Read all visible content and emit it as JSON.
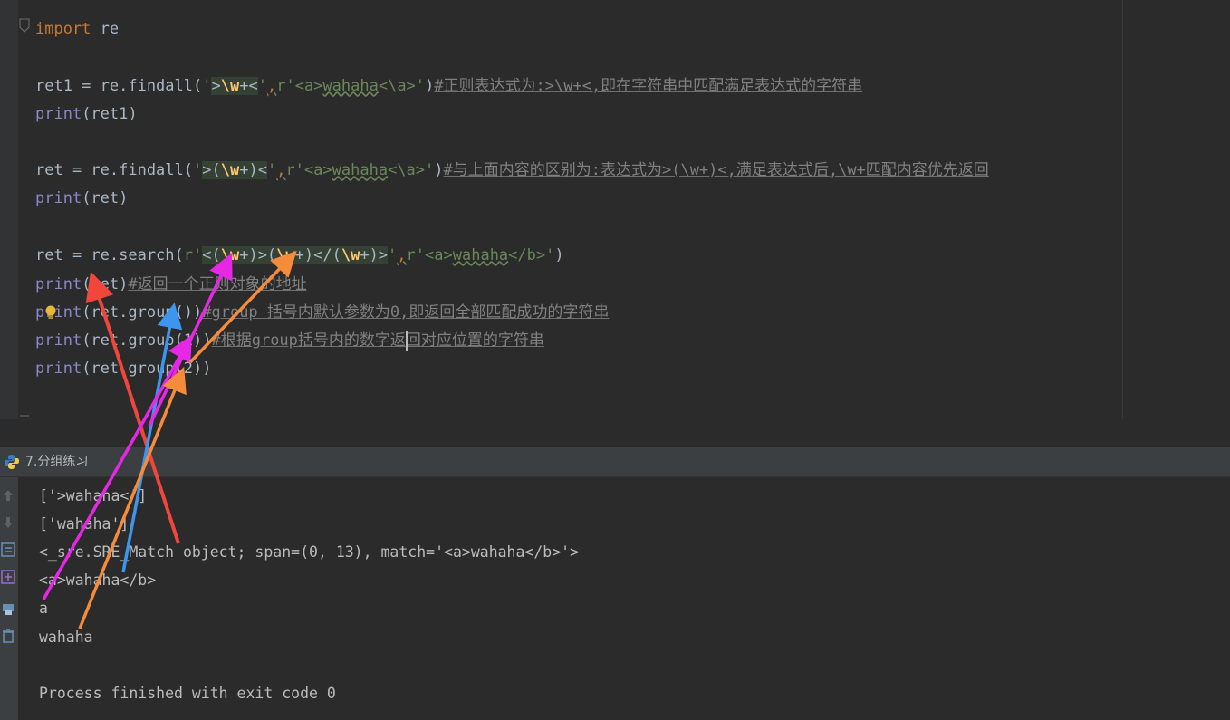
{
  "editor": {
    "line1": {
      "kw": "import",
      "rest": " re"
    },
    "line2": {
      "a": "ret1 = re.findall(",
      "q1": "'",
      "r1": ">",
      "r2": "\\w",
      "r3": "+",
      "r4": "<",
      "q2": "'",
      ",": ",",
      "r": "r'",
      "s": "<a>",
      "w": "wahaha",
      "e": "<\\a>",
      "q3": "'",
      ")": ")",
      "c": "#正则表达式为:>\\w+<,即在字符串中匹配满足表达式的字符串"
    },
    "line3": {
      "fn": "print",
      "rest": "(ret1)"
    },
    "line4": {
      "a": "ret = re.findall(",
      "q1": "'",
      "r1": ">(",
      "r2": "\\w",
      "r3": "+)<",
      "q2": "'",
      ",": ",",
      "r": "r'",
      "s": "<a>",
      "w": "wahaha",
      "e": "<\\a>",
      "q3": "'",
      ")": ")",
      "c": "#与上面内容的区别为:表达式为>(\\w+)<,满足表达式后,\\w+匹配内容优先返回"
    },
    "line5": {
      "fn": "print",
      "rest": "(ret)"
    },
    "line6": {
      "a": "ret = re.search(",
      "r0": "r'",
      "g1a": "<(",
      "g1b": "\\w",
      "g1c": "+)>(",
      "g2b": "\\w",
      "g2c": "+)</(",
      "g3b": "\\w",
      "g3c": "+)>",
      "q2": "'",
      ",": ",",
      "r": "r'",
      "s": "<a>",
      "w": "wahaha",
      "e": "</b>",
      "q3": "'",
      ")": ")"
    },
    "line7": {
      "fn": "print",
      "rest": "(ret)",
      "c": "#返回一个正则对象的地址"
    },
    "line8": {
      "fn": "print",
      "rest": "(ret.group())",
      "c": "#group 括号内默认参数为0,即返回全部匹配成功的字符串"
    },
    "line9": {
      "fn": "print",
      "rest": "(ret.group(1))",
      "c": "#根据group括号内的数字返回对应位置的字符串"
    },
    "line10": {
      "fn": "print",
      "rest": "(ret.group(2))"
    }
  },
  "run_panel": {
    "tab_label": "7.分组练习"
  },
  "console": {
    "lines": [
      "['>wahaha<']",
      "['wahaha']",
      "<_sre.SRE_Match object; span=(0, 13), match='<a>wahaha</b>'>",
      "<a>wahaha</b>",
      "a",
      "wahaha",
      "",
      "Process finished with exit code 0"
    ]
  },
  "colors": {
    "arrow_red": "#f0463c",
    "arrow_blue": "#3c96f0",
    "arrow_magenta": "#e628e6",
    "arrow_orange": "#f58c3c"
  },
  "icons": [
    "fold-icon",
    "bulb-icon",
    "python-icon",
    "up-arrow-icon",
    "down-arrow-icon",
    "rerun-icon",
    "restore-icon",
    "print-icon",
    "trash-icon"
  ]
}
